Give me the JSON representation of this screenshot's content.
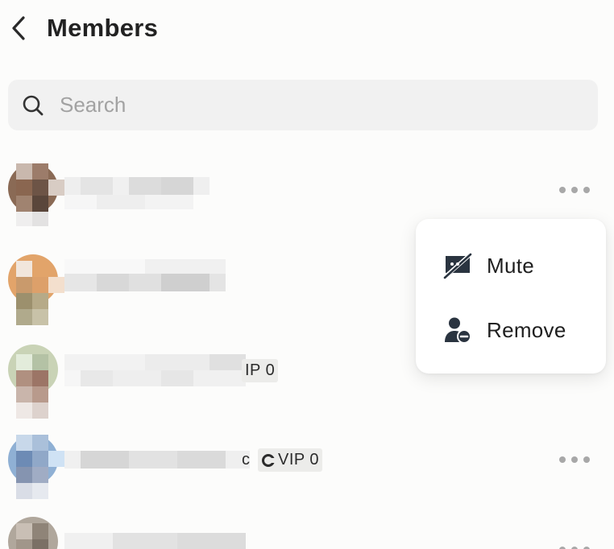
{
  "header": {
    "title": "Members",
    "back_icon": "chevron-left-icon"
  },
  "search": {
    "placeholder": "Search",
    "value": "",
    "icon": "search-icon"
  },
  "members": [
    {
      "badge": null
    },
    {
      "badge": null
    },
    {
      "badge": {
        "text": "IP 0"
      }
    },
    {
      "badge": {
        "prefix": "c",
        "text": "VIP 0",
        "icon": "vip-ring-icon"
      }
    },
    {
      "badge": null
    }
  ],
  "menu": {
    "items": [
      {
        "label": "Mute",
        "icon": "mute-chat-icon"
      },
      {
        "label": "Remove",
        "icon": "remove-user-icon"
      }
    ]
  },
  "colors": {
    "background": "#fcfcfb",
    "search_bg": "#f1f1f1",
    "badge_bg": "#ececea",
    "more_dots": "#a8a8a8",
    "text": "#1f1f1f"
  }
}
